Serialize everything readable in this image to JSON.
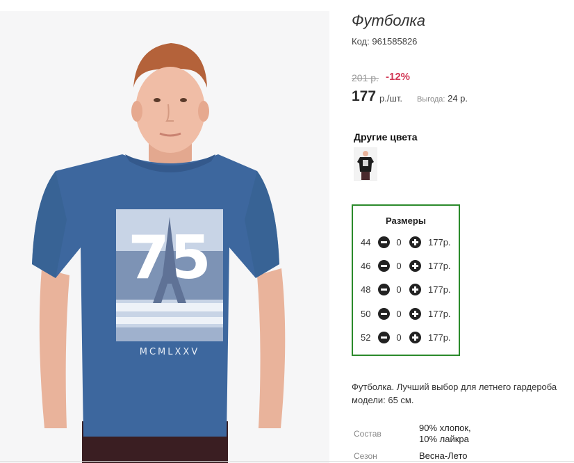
{
  "product": {
    "title": "Футболка",
    "sku_label": "Код:",
    "sku": "961585826",
    "old_price": "201 р.",
    "discount": "-12%",
    "price": "177",
    "price_unit": "р./шт.",
    "benefit_label": "Выгода:",
    "benefit_value": "24 р.",
    "print_number": "75",
    "print_text": "MCMLXXV"
  },
  "colors": {
    "title": "Другие цвета"
  },
  "sizes": {
    "title": "Размеры",
    "rows": [
      {
        "size": "44",
        "qty": "0",
        "price": "177р."
      },
      {
        "size": "46",
        "qty": "0",
        "price": "177р."
      },
      {
        "size": "48",
        "qty": "0",
        "price": "177р."
      },
      {
        "size": "50",
        "qty": "0",
        "price": "177р."
      },
      {
        "size": "52",
        "qty": "0",
        "price": "177р."
      }
    ]
  },
  "description": {
    "line1": "Футболка. Лучший выбор для летнего гардероба",
    "line2": "модели: 65 см."
  },
  "attributes": [
    {
      "label": "Состав",
      "value_lines": [
        "90% хлопок,",
        "10% лайкра"
      ]
    },
    {
      "label": "Сезон",
      "value_lines": [
        "Весна-Лето"
      ]
    }
  ],
  "colors_palette": {
    "accent_red": "#d23a57",
    "box_border": "#2b8a2b",
    "shirt_blue": "#3d679e"
  }
}
